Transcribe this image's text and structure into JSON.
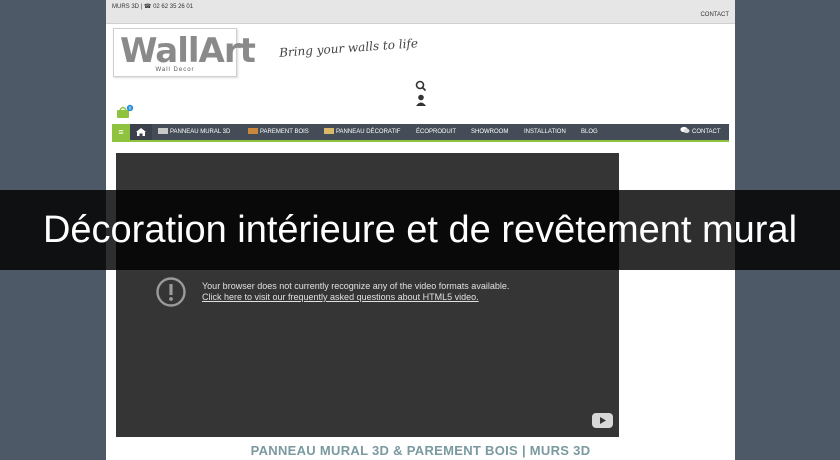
{
  "topbar": {
    "brand": "MURS 3D",
    "separator": "|",
    "phone": "☎ 02 62 35 26 01",
    "contact": "CONTACT"
  },
  "logo": {
    "mark": "WallArt",
    "sub": "Wall Decor"
  },
  "tagline": "Bring your walls to life",
  "icons": {
    "search": "search-icon",
    "user": "user-icon",
    "cart": "cart-icon",
    "cart_badge": "0"
  },
  "nav": {
    "menu_glyph": "≡",
    "items": [
      {
        "label": "PANNEAU MURAL 3D"
      },
      {
        "label": "PAREMENT BOIS"
      },
      {
        "label": "PANNEAU DÉCORATIF"
      },
      {
        "label": "ÉCOPRODUIT"
      },
      {
        "label": "SHOWROOM"
      },
      {
        "label": "INSTALLATION"
      },
      {
        "label": "BLOG"
      }
    ],
    "contact": "CONTACT"
  },
  "video": {
    "message_line1": "Your browser does not currently recognize any of the video formats available.",
    "message_line2": "Click here to visit our frequently asked questions about HTML5 video."
  },
  "section_title": "PANNEAU MURAL 3D & PAREMENT BOIS | MURS 3D",
  "overlay_title": "Décoration intérieure et de revêtement mural",
  "colors": {
    "accent": "#8fc23e",
    "nav_bg": "#444d57",
    "page_bg": "#4d5966"
  }
}
